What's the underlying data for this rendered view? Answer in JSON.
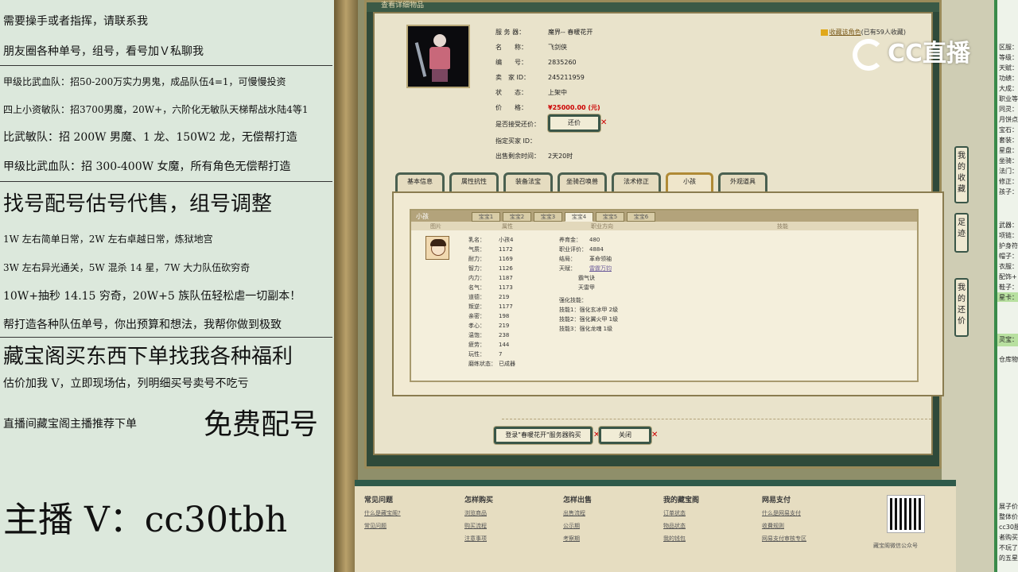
{
  "left_panel": {
    "lines": [
      "需要操手或者指挥，请联系我",
      "朋友圈各种单号，组号，看号加Ｖ私聊我",
      "甲级比武血队：招50-200万实力男鬼，成品队伍4=1，可慢慢投资",
      "四上小资敏队：招3700男魔，20W+，六阶化无敏队天梯帮战水陆4等1",
      "比武敏队：招 200W 男魔、1 龙、150W2 龙，无偿帮打造",
      "甲级比武血队：招 300-400W 女魔，所有角色无偿帮打造",
      "找号配号估号代售，组号调整",
      "1W 左右简单日常，2W 左右卓越日常，炼狱地宫",
      "3W 左右异光通关，5W 混杀 14 星，7W 大力队伍砍穷奇",
      "10W+抽秒 14.15 穷奇，20W+5 族队伍轻松虐一切副本！",
      "帮打造各种队伍单号，你出预算和想法，我帮你做到极致",
      "藏宝阁买东西下单找我各种福利",
      "估价加我 V，立即现场估，列明细买号卖号不吃亏",
      "直播间藏宝阁主播推荐下单",
      "免费配号",
      "主播 V：cc30tbh"
    ]
  },
  "dialog": {
    "title": "查看详细物品",
    "info": [
      {
        "label": "服 务 器：",
        "value": "魔界-- 春暖花开"
      },
      {
        "label": "名　　称：",
        "value": "飞剑侠"
      },
      {
        "label": "编　　号：",
        "value": "2835260"
      },
      {
        "label": "卖　家 ID：",
        "value": "245211959"
      },
      {
        "label": "状　　态：",
        "value": "上架中"
      },
      {
        "label": "价　　格：",
        "value": "¥25000.00 (元)"
      },
      {
        "label": "是否接受还价：",
        "value": ""
      },
      {
        "label": "指定买家 ID：",
        "value": ""
      },
      {
        "label": "出售剩余时间：",
        "value": "2天20时"
      }
    ],
    "favorite_link": "收藏该角色",
    "favorite_count": "(已有59人收藏)",
    "counter_offer_button": "还价",
    "main_tabs": [
      "基本信息",
      "属性抗性",
      "装备法宝",
      "坐骑召唤兽",
      "法术修正",
      "小孩",
      "外观道具"
    ],
    "active_main_tab": "小孩",
    "child_panel": {
      "title": "小孩",
      "sub_tabs": [
        "宝宝1",
        "宝宝2",
        "宝宝3",
        "宝宝4",
        "宝宝5",
        "宝宝6"
      ],
      "active_sub_tab": "宝宝4",
      "col_headers": [
        "图片",
        "属性",
        "职业方向",
        "技能"
      ],
      "stats": [
        {
          "label": "乳名：",
          "value": "小孩4"
        },
        {
          "label": "气质：",
          "value": "1172"
        },
        {
          "label": "耐力：",
          "value": "1169"
        },
        {
          "label": "智力：",
          "value": "1126"
        },
        {
          "label": "内力：",
          "value": "1187"
        },
        {
          "label": "名气：",
          "value": "1173"
        },
        {
          "label": "道德：",
          "value": "219"
        },
        {
          "label": "叛逆：",
          "value": "1177"
        },
        {
          "label": "亲密：",
          "value": "198"
        },
        {
          "label": "孝心：",
          "value": "219"
        },
        {
          "label": "温饱：",
          "value": "238"
        },
        {
          "label": "疲劳：",
          "value": "144"
        },
        {
          "label": "玩性：",
          "value": "7"
        },
        {
          "label": "磨练状态：",
          "value": "已成器"
        }
      ],
      "career": [
        {
          "label": "养育金：",
          "value": "480"
        },
        {
          "label": "职业评价：",
          "value": "4884"
        },
        {
          "label": "结局：",
          "value": "革命领袖"
        }
      ],
      "innate_label": "天赋：",
      "innate_links": [
        "雷霆万钧",
        "霸气诀",
        "天雷甲"
      ],
      "enhance_label": "强化技能：",
      "enhance_links": [
        "技能1：强化玄冰甲 2级",
        "技能2：强化翼火甲 1级",
        "技能3：强化龙魂 1级"
      ]
    },
    "login_buy_button": "登录\"春暖花开\"服务器购买",
    "close_button": "关闭"
  },
  "side_tabs": [
    "我的收藏",
    "足迹",
    "我的还价"
  ],
  "footer": {
    "columns": [
      {
        "title": "常见问题",
        "links": [
          "什么是藏宝阁?",
          "常见问题"
        ]
      },
      {
        "title": "怎样购买",
        "links": [
          "浏览商品",
          "购买流程",
          "注意事项"
        ]
      },
      {
        "title": "怎样出售",
        "links": [
          "出售流程",
          "公示期",
          "考察期"
        ]
      },
      {
        "title": "我的藏宝阁",
        "links": [
          "订单状态",
          "物品状态",
          "我的钱包"
        ]
      },
      {
        "title": "网易支付",
        "links": [
          "什么是网易支付",
          "收費规则",
          "网易支付审核专区"
        ]
      }
    ],
    "qr_caption": "藏宝阁微信公众号"
  },
  "watermark": "CC直播",
  "right_strip": {
    "items": [
      "区服：",
      "等级：",
      "天赋：",
      "功绩：",
      "大成：",
      "职业等",
      "同灵：",
      "月饼点",
      "宝石：",
      "套装：",
      "星盘：",
      "坐骑：",
      "法门：",
      "修正：",
      "孩子：",
      "武器：",
      "项链：",
      "护身符",
      "帽子：",
      "衣服：",
      "配饰+",
      "鞋子：",
      "星卡：",
      "灵宝：",
      "仓库物",
      "展子价",
      "整体价",
      "cc30服",
      "者购买",
      "不玩了",
      "的五星"
    ]
  }
}
